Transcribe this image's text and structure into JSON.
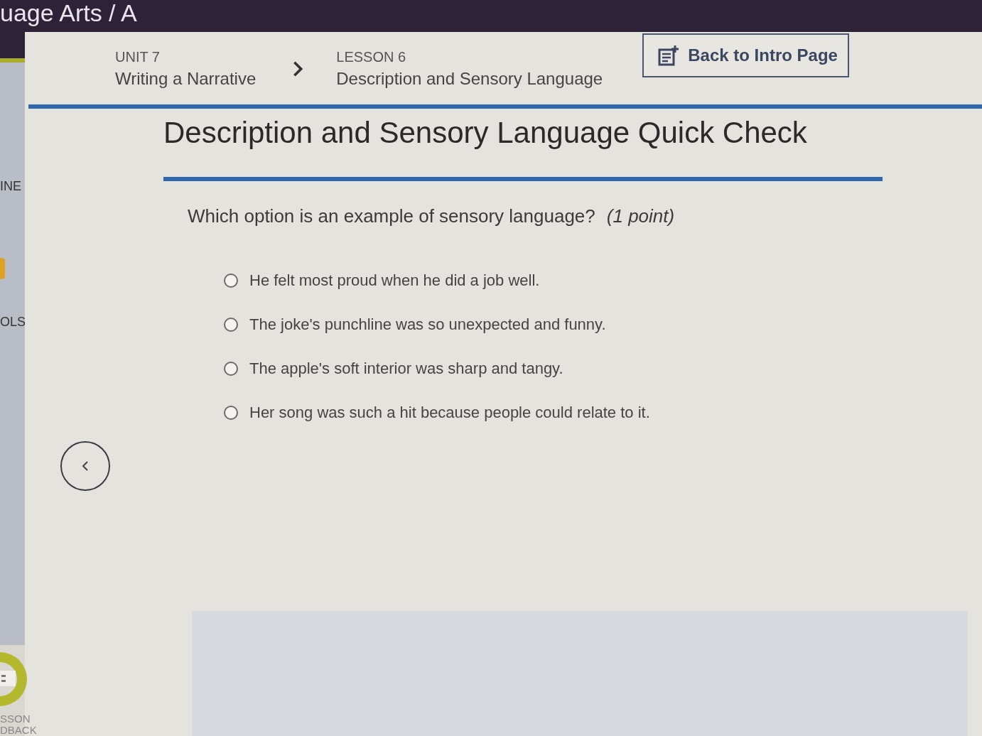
{
  "top_bar": {
    "title": "uage Arts / A"
  },
  "sidebar": {
    "items": [
      {
        "label": "INE"
      },
      {
        "label": "OLS"
      }
    ],
    "bottom_item": {
      "lines": [
        "SSON",
        "DBACK"
      ]
    }
  },
  "breadcrumb": [
    {
      "label": "UNIT 7",
      "title": "Writing a Narrative"
    },
    {
      "label": "LESSON 6",
      "title": "Description and Sensory Language"
    }
  ],
  "back_button": {
    "label": "Back to Intro Page"
  },
  "title": "Description and Sensory Language Quick Check",
  "question": {
    "text": "Which option is an example of sensory language?",
    "points": "(1 point)"
  },
  "options": [
    {
      "text": "He felt most proud when he did a job well.",
      "selected": false
    },
    {
      "text": "The joke's punchline was so unexpected and funny.",
      "selected": false
    },
    {
      "text": "The apple's soft interior was sharp and tangy.",
      "selected": false
    },
    {
      "text": "Her song was such a hit because people could relate to it.",
      "selected": false
    }
  ]
}
